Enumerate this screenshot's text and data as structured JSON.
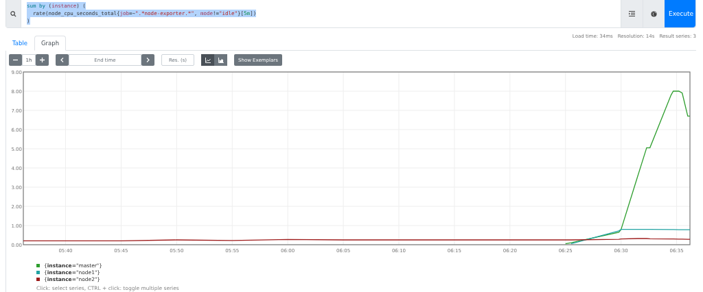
{
  "query": {
    "lines": [
      [
        {
          "kind": "keyword",
          "text": "sum by"
        },
        {
          "kind": "plain",
          "text": " ("
        },
        {
          "kind": "label",
          "text": "instance"
        },
        {
          "kind": "plain",
          "text": ") ("
        }
      ],
      [
        {
          "kind": "plain",
          "text": "  rate(node_cpu_seconds_total{"
        },
        {
          "kind": "label",
          "text": "job"
        },
        {
          "kind": "plain",
          "text": "=~"
        },
        {
          "kind": "string",
          "text": "\".*node-exporter.*\""
        },
        {
          "kind": "plain",
          "text": ", "
        },
        {
          "kind": "label",
          "text": "mode"
        },
        {
          "kind": "plain",
          "text": "!="
        },
        {
          "kind": "string",
          "text": "\"idle\""
        },
        {
          "kind": "plain",
          "text": "}["
        },
        {
          "kind": "duration",
          "text": "5m"
        },
        {
          "kind": "plain",
          "text": "])"
        }
      ],
      [
        {
          "kind": "plain",
          "text": ")"
        }
      ]
    ],
    "execute_label": "Execute"
  },
  "tabs": [
    {
      "label": "Table",
      "selected": false
    },
    {
      "label": "Graph",
      "selected": true
    }
  ],
  "stats": [
    "Load time: 34ms",
    "Resolution: 14s",
    "Result series: 3"
  ],
  "controls": {
    "range": "1h",
    "end_time": {
      "placeholder": "End time"
    },
    "resolution": {
      "placeholder": "Res. (s)"
    },
    "chart_modes": [
      {
        "kind": "line",
        "selected": true
      },
      {
        "kind": "stacked",
        "selected": false
      }
    ],
    "exemplars_label": "Show Exemplars"
  },
  "graph": {
    "chart_data": {
      "type": "line",
      "x": [
        336.2,
        340,
        345,
        350,
        355,
        360,
        365,
        370,
        375,
        380,
        385,
        385.5,
        389.8,
        390,
        391.5,
        392.3,
        392.6,
        394.5,
        394.7,
        395.2,
        395.5,
        396.0,
        396.2
      ],
      "series": [
        {
          "name": "{**instance**=\"master\"}",
          "color": "#2e9e2e",
          "values": [
            null,
            null,
            null,
            null,
            null,
            null,
            null,
            null,
            null,
            null,
            0.05,
            0.1,
            0.65,
            0.8,
            3.57,
            5.05,
            5.05,
            7.8,
            8.0,
            8.0,
            7.9,
            6.7,
            6.7
          ]
        },
        {
          "name": "{**instance**=\"node1\"}",
          "color": "#22a3a3",
          "values": [
            null,
            null,
            null,
            null,
            null,
            null,
            null,
            null,
            null,
            null,
            null,
            0.05,
            0.72,
            0.8,
            0.8,
            0.8,
            0.8,
            0.79,
            0.79,
            0.78,
            0.78,
            0.78,
            0.78
          ]
        },
        {
          "name": "{**instance**=\"node2\"}",
          "color": "#9e1c1c",
          "values": [
            0.2,
            0.2,
            0.2,
            0.25,
            0.22,
            0.27,
            0.25,
            0.25,
            0.25,
            0.25,
            0.25,
            0.25,
            0.28,
            0.3,
            0.32,
            0.32,
            0.31,
            0.3,
            0.3,
            0.29,
            0.29,
            0.28,
            0.28
          ]
        }
      ],
      "xlim": [
        336.2,
        396.2
      ],
      "ylim": [
        0,
        9
      ],
      "grid": true,
      "xticks": [
        {
          "value": 340,
          "label": "05:40"
        },
        {
          "value": 345,
          "label": "05:45"
        },
        {
          "value": 350,
          "label": "05:50"
        },
        {
          "value": 355,
          "label": "05:55"
        },
        {
          "value": 360,
          "label": "06:00"
        },
        {
          "value": 365,
          "label": "06:05"
        },
        {
          "value": 370,
          "label": "06:10"
        },
        {
          "value": 375,
          "label": "06:15"
        },
        {
          "value": 380,
          "label": "06:20"
        },
        {
          "value": 385,
          "label": "06:25"
        },
        {
          "value": 390,
          "label": "06:30"
        },
        {
          "value": 395,
          "label": "06:35"
        }
      ],
      "yticks": [
        {
          "value": 0,
          "label": "0.00"
        },
        {
          "value": 1,
          "label": "1.00"
        },
        {
          "value": 2,
          "label": "2.00"
        },
        {
          "value": 3,
          "label": "3.00"
        },
        {
          "value": 4,
          "label": "4.00"
        },
        {
          "value": 5,
          "label": "5.00"
        },
        {
          "value": 6,
          "label": "6.00"
        },
        {
          "value": 7,
          "label": "7.00"
        },
        {
          "value": 8,
          "label": "8.00"
        },
        {
          "value": 9,
          "label": "9.00"
        }
      ]
    },
    "hint": "Click: select series, CTRL + click: toggle multiple series"
  }
}
